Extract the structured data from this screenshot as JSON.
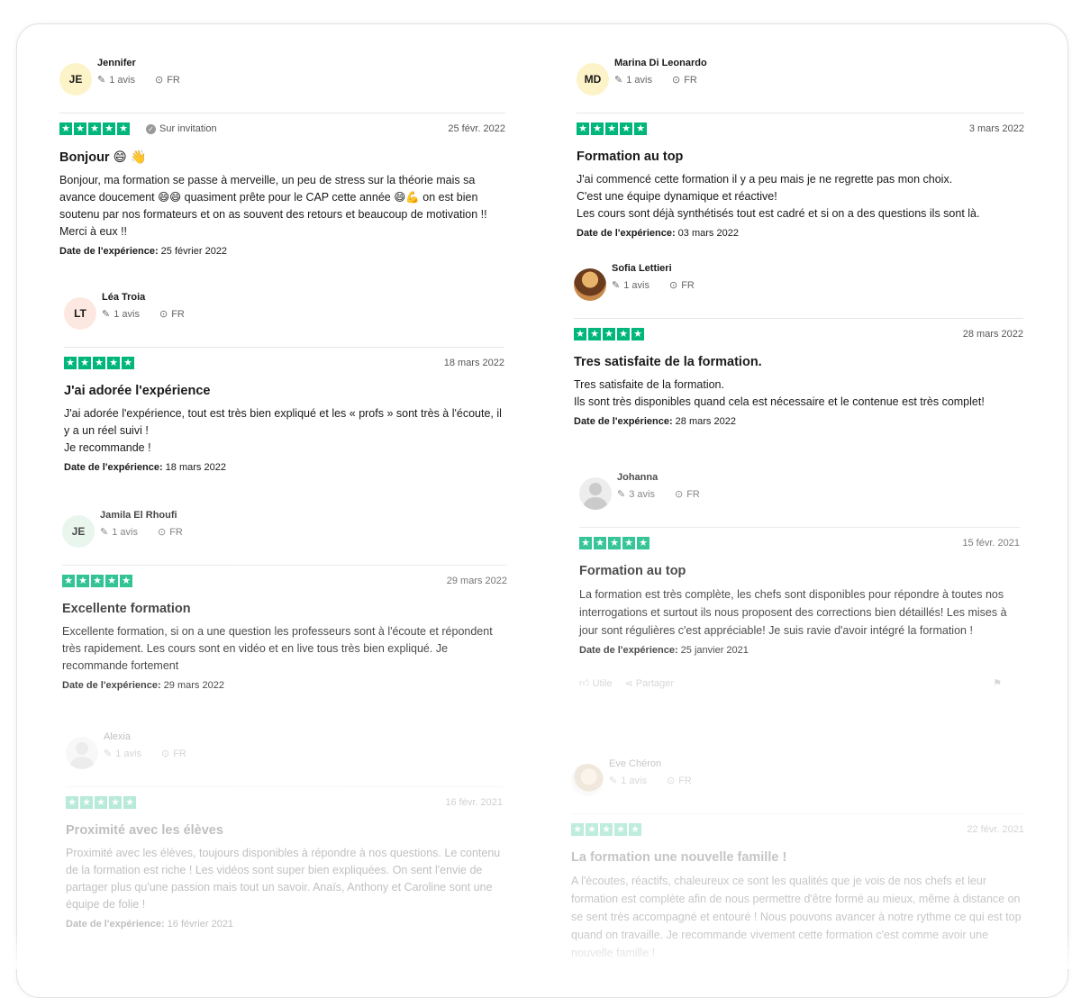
{
  "reviews": [
    {
      "initials": "JE",
      "avatar_color": "#fdf3c8",
      "name": "Jennifer",
      "reviews_count": "1 avis",
      "country": "FR",
      "invitation": "Sur invitation",
      "date": "25 févr. 2022",
      "title": "Bonjour 😄 👋",
      "body": "Bonjour, ma formation se passe à merveille, un peu de stress sur la théorie mais sa avance doucement 😄😄 quasiment prête pour le CAP cette année 😄💪 on est bien soutenu par nos formateurs et on as souvent des retours et beaucoup de motivation !! Merci à eux !!",
      "exp_label": "Date de l'expérience:",
      "exp_date": "25 février 2022"
    },
    {
      "initials": "LT",
      "avatar_color": "#fde8e1",
      "name": "Léa Troia",
      "reviews_count": "1 avis",
      "country": "FR",
      "date": "18 mars 2022",
      "title": "J'ai adorée l'expérience",
      "body": "J'ai adorée l'expérience, tout est très bien expliqué et les « profs » sont très à l'écoute, il y a un réel suivi !\nJe recommande !",
      "exp_label": "Date de l'expérience:",
      "exp_date": "18 mars 2022"
    },
    {
      "initials": "JE",
      "avatar_color": "#e3f4ea",
      "name": "Jamila El Rhoufi",
      "reviews_count": "1 avis",
      "country": "FR",
      "date": "29 mars 2022",
      "title": "Excellente formation",
      "body": "Excellente formation, si on a une question les professeurs sont à l'écoute et répondent très rapidement. Les cours sont en vidéo et en live tous très bien expliqué. Je recommande fortement",
      "exp_label": "Date de l'expérience:",
      "exp_date": "29 mars 2022"
    },
    {
      "name": "Alexia",
      "reviews_count": "1 avis",
      "country": "FR",
      "date": "16 févr. 2021",
      "title": "Proximité avec les élèves",
      "body": "Proximité avec les élèves, toujours disponibles à répondre à nos questions. Le contenu de la formation est riche ! Les vidéos sont super bien expliquées. On sent l'envie de partager plus qu'une passion mais tout un savoir. Anaïs, Anthony et Caroline sont une équipe de folie !",
      "exp_label": "Date de l'expérience:",
      "exp_date": "16 février 2021"
    },
    {
      "initials": "MD",
      "avatar_color": "#fdf3c8",
      "name": "Marina Di Leonardo",
      "reviews_count": "1 avis",
      "country": "FR",
      "date": "3 mars 2022",
      "title": "Formation au top",
      "body": "J'ai commencé cette formation il y a peu mais je ne regrette pas mon choix.\nC'est une équipe dynamique et réactive!\nLes cours sont déjà synthétisés tout est cadré et si on a des questions ils sont là.",
      "exp_label": "Date de l'expérience:",
      "exp_date": "03 mars 2022"
    },
    {
      "name": "Sofia Lettieri",
      "reviews_count": "1 avis",
      "country": "FR",
      "date": "28 mars 2022",
      "title": "Tres satisfaite de la formation.",
      "body": "Tres satisfaite de la formation.\nIls sont très disponibles quand cela est nécessaire et le contenue est très complet!",
      "exp_label": "Date de l'expérience:",
      "exp_date": "28 mars 2022"
    },
    {
      "name": "Johanna",
      "reviews_count": "3 avis",
      "country": "FR",
      "date": "15 févr. 2021",
      "title": "Formation au top",
      "body": "La formation est très complète, les chefs sont disponibles pour répondre à toutes nos interrogations et surtout ils nous proposent des corrections bien détaillés! Les mises à jour sont régulières c'est appréciable! Je suis ravie d'avoir intégré la formation !",
      "exp_label": "Date de l'expérience:",
      "exp_date": "25 janvier 2021",
      "useful_label": "Utile",
      "share_label": "Partager"
    },
    {
      "name": "Eve Chéron",
      "reviews_count": "1 avis",
      "country": "FR",
      "date": "22 févr. 2021",
      "title": "La formation une nouvelle famille !",
      "body": "A l'écoutes, réactifs, chaleureux ce sont les qualités que je vois de nos chefs et leur formation est complète afin de nous permettre d'être formé au mieux, même à distance on se sent très accompagné et entouré ! Nous pouvons avancer à notre rythme ce qui est top quand on travaille. Je recommande vivement cette formation c'est comme avoir une nouvelle famille !"
    }
  ],
  "colors": {
    "trustpilot_green": "#00b67a"
  }
}
